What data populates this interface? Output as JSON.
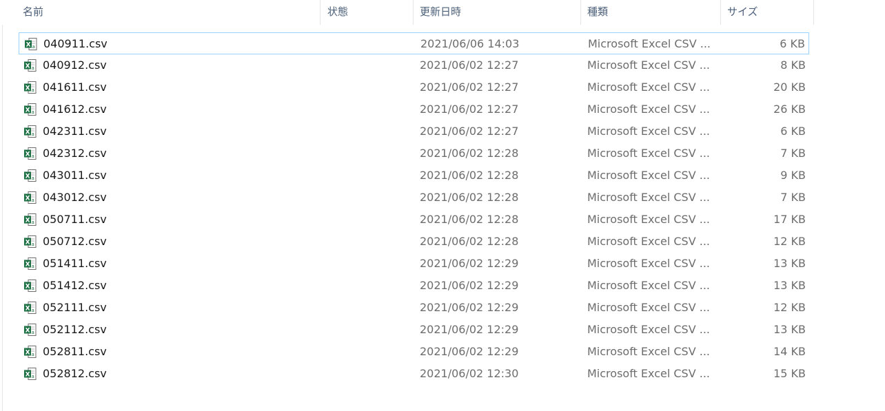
{
  "columns": {
    "name": "名前",
    "status": "状態",
    "modified": "更新日時",
    "type": "種類",
    "size": "サイズ"
  },
  "sort_indicator": "^",
  "colors": {
    "excel_green": "#1e7145",
    "selection_border": "#99d1ff",
    "header_text": "#4c607a"
  },
  "files": [
    {
      "name": "040911.csv",
      "modified": "2021/06/06 14:03",
      "type": "Microsoft Excel CSV ...",
      "size": "6 KB",
      "icon": "excel-csv-icon"
    },
    {
      "name": "040912.csv",
      "modified": "2021/06/02 12:27",
      "type": "Microsoft Excel CSV ...",
      "size": "8 KB",
      "icon": "excel-csv-icon"
    },
    {
      "name": "041611.csv",
      "modified": "2021/06/02 12:27",
      "type": "Microsoft Excel CSV ...",
      "size": "20 KB",
      "icon": "excel-csv-icon"
    },
    {
      "name": "041612.csv",
      "modified": "2021/06/02 12:27",
      "type": "Microsoft Excel CSV ...",
      "size": "26 KB",
      "icon": "excel-csv-icon"
    },
    {
      "name": "042311.csv",
      "modified": "2021/06/02 12:27",
      "type": "Microsoft Excel CSV ...",
      "size": "6 KB",
      "icon": "excel-csv-icon"
    },
    {
      "name": "042312.csv",
      "modified": "2021/06/02 12:28",
      "type": "Microsoft Excel CSV ...",
      "size": "7 KB",
      "icon": "excel-csv-icon"
    },
    {
      "name": "043011.csv",
      "modified": "2021/06/02 12:28",
      "type": "Microsoft Excel CSV ...",
      "size": "9 KB",
      "icon": "excel-csv-icon"
    },
    {
      "name": "043012.csv",
      "modified": "2021/06/02 12:28",
      "type": "Microsoft Excel CSV ...",
      "size": "7 KB",
      "icon": "excel-csv-icon"
    },
    {
      "name": "050711.csv",
      "modified": "2021/06/02 12:28",
      "type": "Microsoft Excel CSV ...",
      "size": "17 KB",
      "icon": "excel-csv-icon"
    },
    {
      "name": "050712.csv",
      "modified": "2021/06/02 12:28",
      "type": "Microsoft Excel CSV ...",
      "size": "12 KB",
      "icon": "excel-csv-icon"
    },
    {
      "name": "051411.csv",
      "modified": "2021/06/02 12:29",
      "type": "Microsoft Excel CSV ...",
      "size": "13 KB",
      "icon": "excel-csv-icon"
    },
    {
      "name": "051412.csv",
      "modified": "2021/06/02 12:29",
      "type": "Microsoft Excel CSV ...",
      "size": "13 KB",
      "icon": "excel-csv-icon"
    },
    {
      "name": "052111.csv",
      "modified": "2021/06/02 12:29",
      "type": "Microsoft Excel CSV ...",
      "size": "12 KB",
      "icon": "excel-csv-icon"
    },
    {
      "name": "052112.csv",
      "modified": "2021/06/02 12:29",
      "type": "Microsoft Excel CSV ...",
      "size": "13 KB",
      "icon": "excel-csv-icon"
    },
    {
      "name": "052811.csv",
      "modified": "2021/06/02 12:29",
      "type": "Microsoft Excel CSV ...",
      "size": "14 KB",
      "icon": "excel-csv-icon"
    },
    {
      "name": "052812.csv",
      "modified": "2021/06/02 12:30",
      "type": "Microsoft Excel CSV ...",
      "size": "15 KB",
      "icon": "excel-csv-icon"
    }
  ]
}
